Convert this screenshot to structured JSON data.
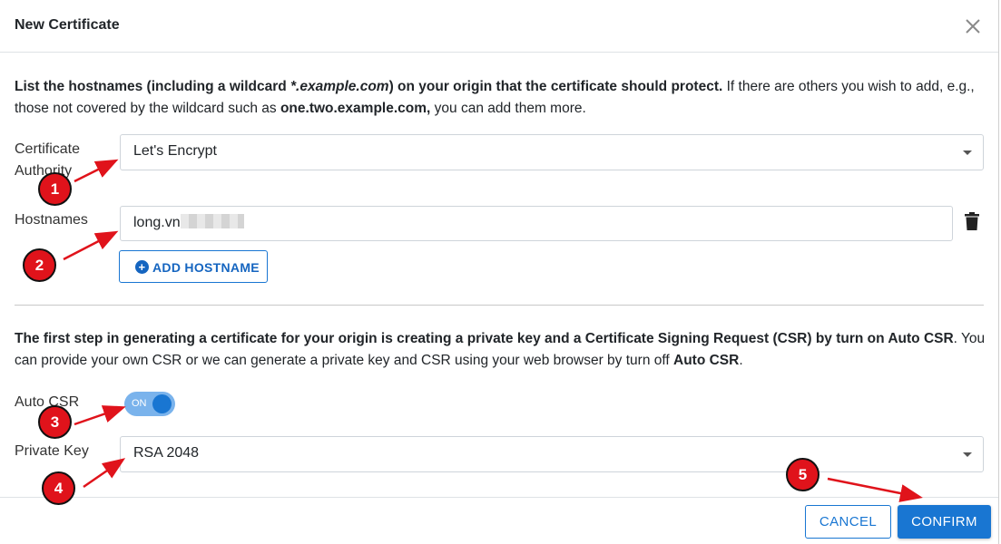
{
  "dialog": {
    "title": "New Certificate",
    "close_icon": "close-icon"
  },
  "intro": {
    "bold_lead": "List the hostnames (including a wildcard ",
    "wildcard": "*.example.com",
    "bold_mid": ") on your origin that the certificate should protect.",
    "normal1": " If there are others you wish to add, e.g., those not covered by the wildcard such as ",
    "bold_example": "one.two.example.com,",
    "normal2": " you can add them more."
  },
  "certificate_authority": {
    "label_line1": "Certificate",
    "label_line2": "Authority",
    "value": "Let's Encrypt"
  },
  "hostnames": {
    "label": "Hostnames",
    "value": "long.vn",
    "trash_icon": "trash-icon",
    "add_button": "ADD HOSTNAME",
    "add_icon": "plus-circle-icon"
  },
  "csr_info": {
    "bold1": "The first step in generating a certificate for your origin is creating a private key and a Certificate Signing Request (CSR) by turn on ",
    "bold_auto1": "Auto CSR",
    "normal1": ". You can provide your own CSR or we can generate a private key and CSR using your web browser by turn off ",
    "bold_auto2": "Auto CSR",
    "normal2": "."
  },
  "auto_csr": {
    "label": "Auto CSR",
    "toggle_text": "ON"
  },
  "private_key": {
    "label": "Private Key",
    "value": "RSA 2048"
  },
  "footer": {
    "cancel": "CANCEL",
    "confirm": "CONFIRM"
  },
  "markers": [
    "1",
    "2",
    "3",
    "4",
    "5"
  ],
  "colors": {
    "primary": "#1976d2",
    "marker_red": "#e0131b",
    "toggle_track": "#7ab3ec"
  }
}
